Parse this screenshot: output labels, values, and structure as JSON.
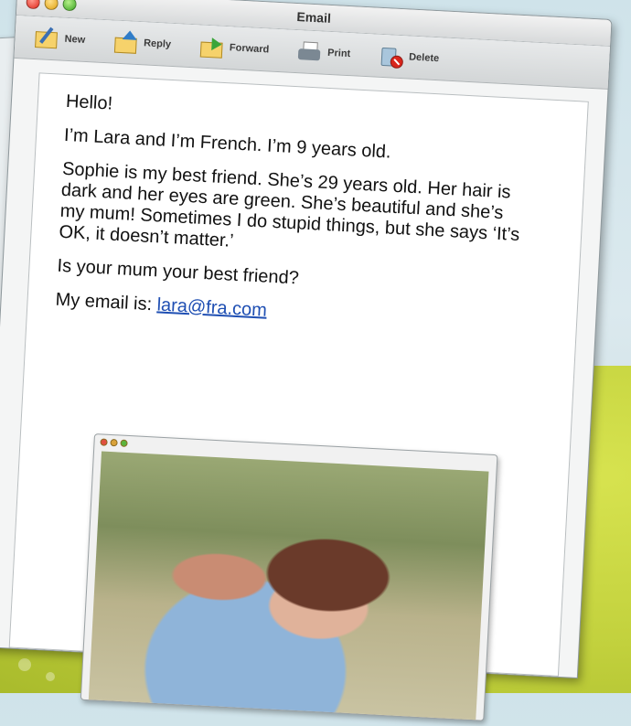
{
  "window": {
    "title": "Email"
  },
  "toolbar": {
    "new_label": "New",
    "reply_label": "Reply",
    "forward_label": "Forward",
    "print_label": "Print",
    "delete_label": "Delete"
  },
  "message": {
    "greeting": "Hello!",
    "line1": "I’m Lara and I’m French. I’m 9 years old.",
    "paragraph": "Sophie is my best friend. She’s 29 years old. Her hair is dark and her eyes are green. She’s beautiful and she’s my mum! Sometimes I do stupid things, but she says ‘It’s OK, it doesn’t matter.’",
    "question": "Is your mum your best friend?",
    "email_prefix": "My email is: ",
    "email_link": "lara@fra.com"
  },
  "icons": {
    "new": "new-message-icon",
    "reply": "reply-icon",
    "forward": "forward-icon",
    "print": "printer-icon",
    "delete": "delete-icon"
  },
  "colors": {
    "link": "#1f4fb3",
    "background_green": "#c2d13d"
  }
}
